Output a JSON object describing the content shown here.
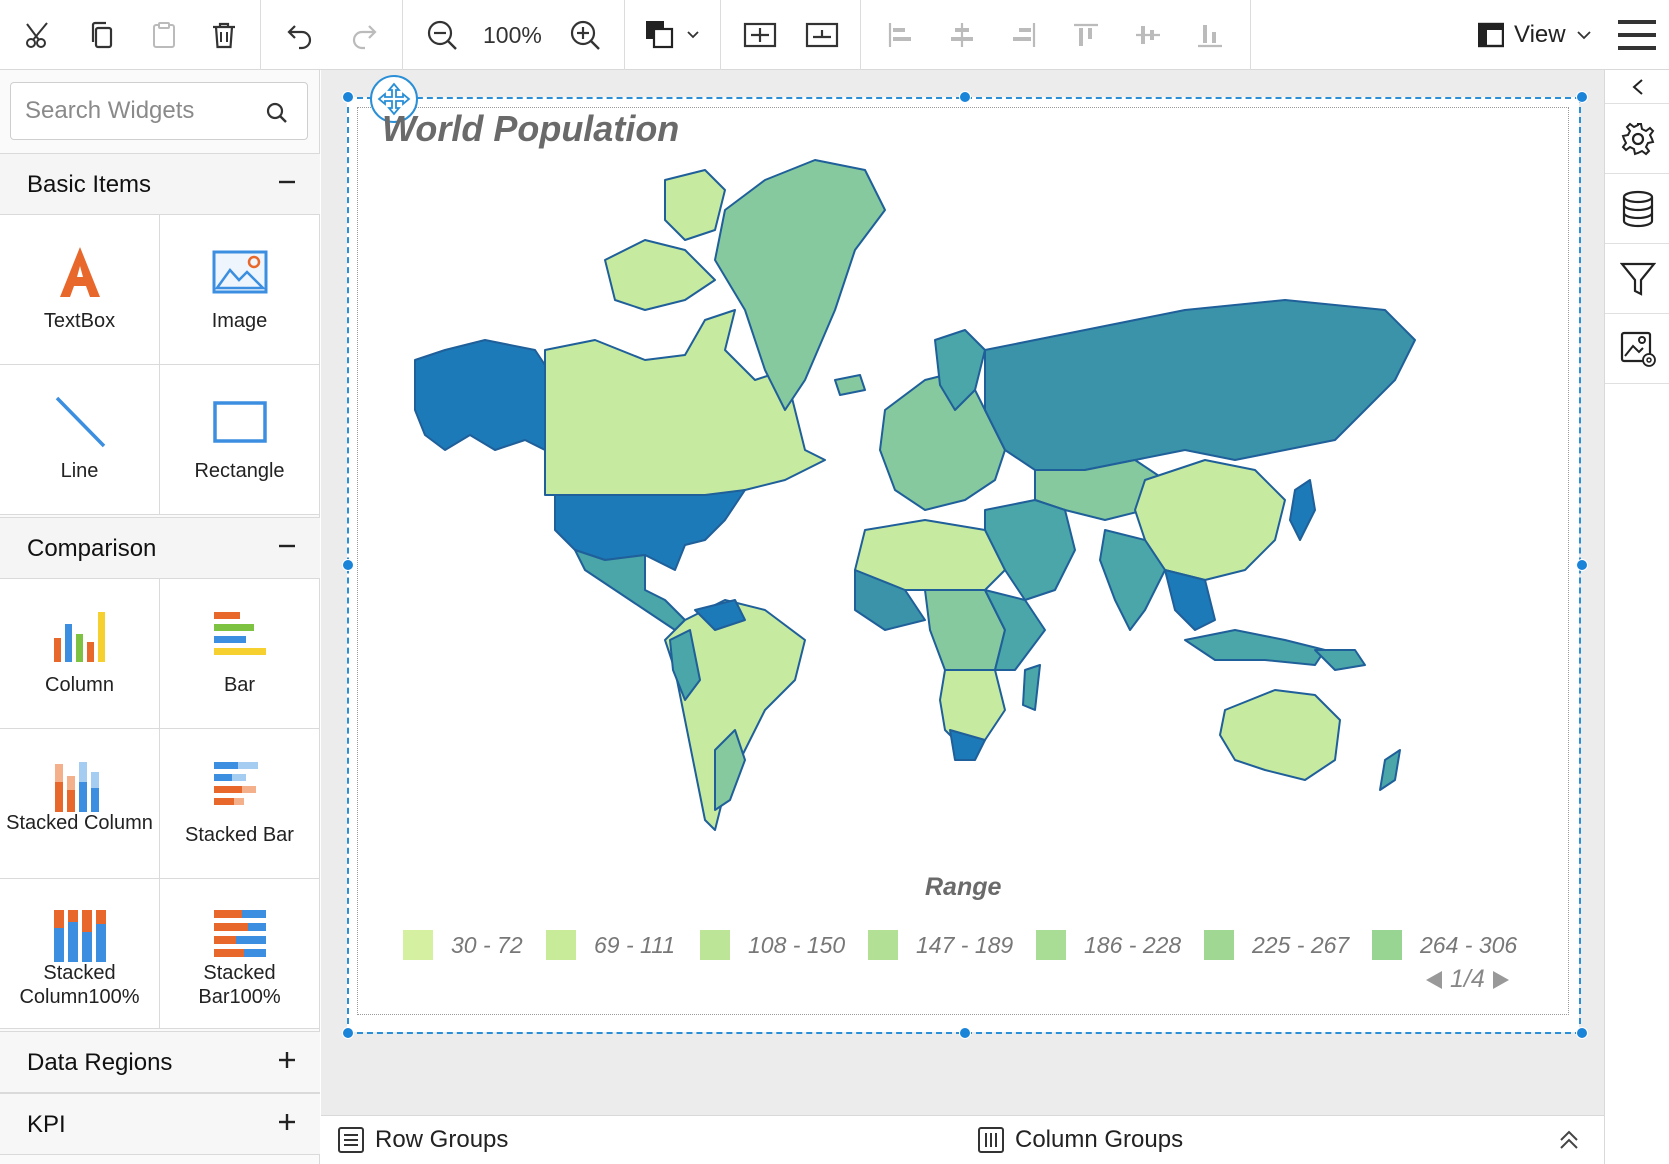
{
  "toolbar": {
    "zoom_level": "100%",
    "view_label": "View",
    "icons": [
      "cut-icon",
      "copy-icon",
      "paste-icon",
      "delete-icon",
      "undo-icon",
      "redo-icon",
      "zoom-out-icon",
      "zoom-in-icon",
      "fill-color-icon",
      "align-horizontal-icon",
      "align-vertical-icon",
      "align-left-icon",
      "align-center-icon",
      "align-right-icon",
      "align-top-icon",
      "align-middle-icon",
      "align-bottom-icon",
      "view-layout-icon",
      "hamburger-menu-icon"
    ]
  },
  "sidebar": {
    "search_placeholder": "Search Widgets",
    "categories": [
      {
        "label": "Basic Items",
        "state": "expanded",
        "items": [
          {
            "label": "TextBox",
            "icon": "textbox-icon"
          },
          {
            "label": "Image",
            "icon": "image-icon"
          },
          {
            "label": "Line",
            "icon": "line-icon"
          },
          {
            "label": "Rectangle",
            "icon": "rectangle-icon"
          }
        ]
      },
      {
        "label": "Comparison",
        "state": "expanded",
        "items": [
          {
            "label": "Column",
            "icon": "column-chart-icon"
          },
          {
            "label": "Bar",
            "icon": "bar-chart-icon"
          },
          {
            "label": "Stacked Column",
            "icon": "stacked-column-icon"
          },
          {
            "label": "Stacked Bar",
            "icon": "stacked-bar-icon"
          },
          {
            "label": "Stacked Column100%",
            "icon": "stacked-column100-icon"
          },
          {
            "label": "Stacked Bar100%",
            "icon": "stacked-bar100-icon"
          }
        ]
      },
      {
        "label": "Data Regions",
        "state": "collapsed"
      },
      {
        "label": "KPI",
        "state": "collapsed"
      }
    ]
  },
  "report": {
    "title": "World Population",
    "legend_title": "Range",
    "legend": [
      {
        "label": "30 - 72",
        "color": "#d4f0a0"
      },
      {
        "label": "69 - 111",
        "color": "#c8eb9a"
      },
      {
        "label": "108 - 150",
        "color": "#bde597"
      },
      {
        "label": "147 - 189",
        "color": "#b2e095"
      },
      {
        "label": "186 - 228",
        "color": "#a9dc94"
      },
      {
        "label": "225 - 267",
        "color": "#a0d893"
      },
      {
        "label": "264 - 306",
        "color": "#98d492"
      }
    ],
    "page_indicator": "1/4",
    "map_palette": {
      "border": "#1f5f9a",
      "light": "#c6eaa0",
      "mid": "#86c99e",
      "teal": "#4aa6a8",
      "dark_teal": "#3a93a8",
      "blue": "#1d7ab8"
    }
  },
  "bottom_bar": {
    "row_groups_label": "Row Groups",
    "column_groups_label": "Column Groups"
  },
  "right_rail": {
    "icons": [
      "collapse-left-icon",
      "settings-gear-icon",
      "database-icon",
      "filter-icon",
      "image-settings-icon"
    ]
  },
  "colors": {
    "accent": "#2a8fd6",
    "textbox_orange": "#e8682c",
    "image_blue": "#3b8ee0"
  }
}
